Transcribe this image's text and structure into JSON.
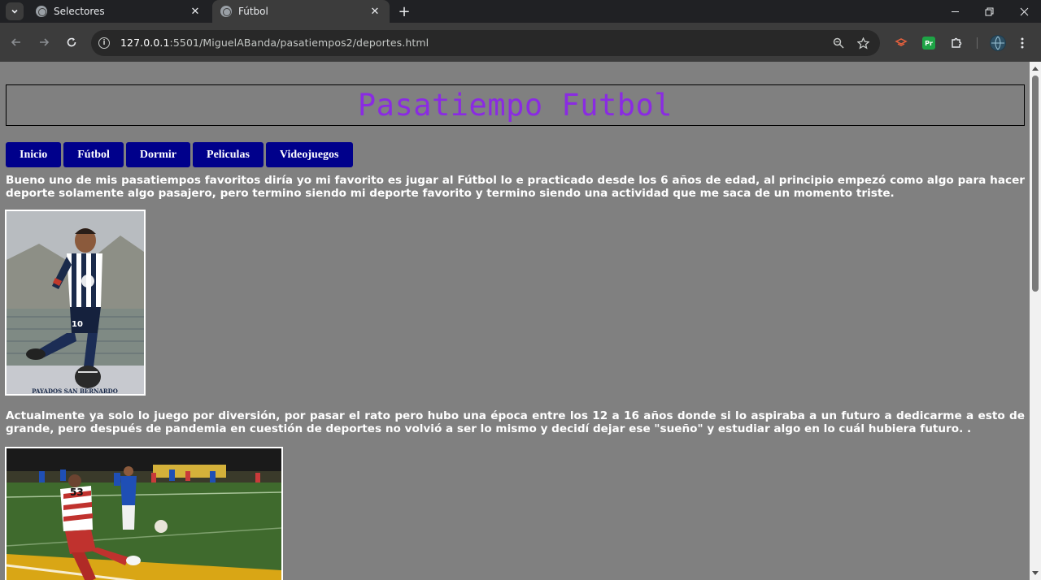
{
  "browser": {
    "tabs": [
      {
        "title": "Selectores",
        "active": false
      },
      {
        "title": "Fútbol",
        "active": true
      }
    ],
    "url_host": "127.0.0.1",
    "url_rest": ":5501/MiguelABanda/pasatiempos2/deportes.html",
    "extensions": [
      {
        "name": "extension-pr",
        "label": "Pr",
        "color": "#1ea446"
      }
    ]
  },
  "page": {
    "title": "Pasatiempo Futbol",
    "title_color": "#8a2be2",
    "nav": [
      "Inicio",
      "Fútbol",
      "Dormir",
      "Peliculas",
      "Videojuegos"
    ],
    "nav_color": "#00008b",
    "paragraphs": [
      "Bueno uno de mis pasatiempos favoritos diría yo mi favorito es jugar al Fútbol lo e practicado desde los 6 años de edad, al principio empezó como algo para hacer deporte solamente algo pasajero, pero termino siendo mi deporte favorito y termino siendo una actividad que me saca de un momento triste.",
      "Actualmente ya solo lo juego por diversión, por pasar el rato pero hubo una época entre los 12 a 16 años donde si lo aspiraba a un futuro a dedicarme a esto de grande, pero después de pandemia en cuestión de deportes no volvió a ser lo mismo y decidí dejar ese \"sueño\" y estudiar algo en lo cuál hubiera futuro. ."
    ],
    "photo1_caption": "PAYADOS SAN BERNARDO",
    "photo1_jersey": "10",
    "photo2_jersey": "53"
  }
}
